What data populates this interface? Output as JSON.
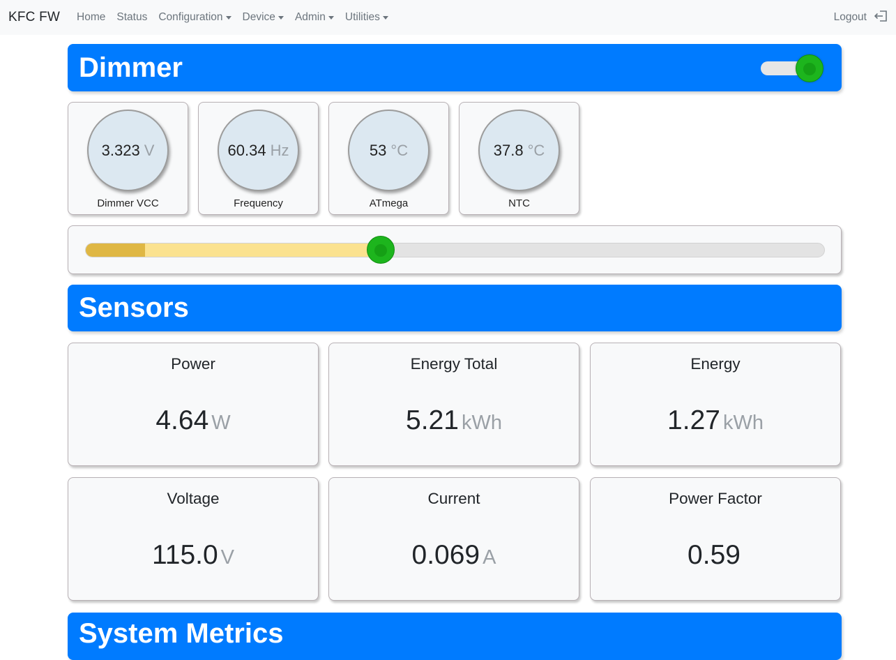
{
  "navbar": {
    "brand": "KFC FW",
    "items": [
      {
        "label": "Home",
        "dropdown": false
      },
      {
        "label": "Status",
        "dropdown": false
      },
      {
        "label": "Configuration",
        "dropdown": true
      },
      {
        "label": "Device",
        "dropdown": true
      },
      {
        "label": "Admin",
        "dropdown": true
      },
      {
        "label": "Utilities",
        "dropdown": true
      }
    ],
    "logout_label": "Logout",
    "logout_icon": "logout-icon"
  },
  "dimmer": {
    "title": "Dimmer",
    "enabled": true,
    "gauges": [
      {
        "value": "3.323",
        "unit": "V",
        "label": "Dimmer VCC"
      },
      {
        "value": "60.34",
        "unit": "Hz",
        "label": "Frequency"
      },
      {
        "value": "53",
        "unit": "°C",
        "label": "ATmega"
      },
      {
        "value": "37.8",
        "unit": "°C",
        "label": "NTC"
      }
    ],
    "level": 0.4,
    "min_level": 0.08
  },
  "sensors": {
    "title": "Sensors",
    "cards": [
      {
        "title": "Power",
        "value": "4.64",
        "unit": "W"
      },
      {
        "title": "Energy Total",
        "value": "5.21",
        "unit": "kWh"
      },
      {
        "title": "Energy",
        "value": "1.27",
        "unit": "kWh"
      },
      {
        "title": "Voltage",
        "value": "115.0",
        "unit": "V"
      },
      {
        "title": "Current",
        "value": "0.069",
        "unit": "A"
      },
      {
        "title": "Power Factor",
        "value": "0.59",
        "unit": ""
      }
    ]
  },
  "system_metrics": {
    "title": "System Metrics"
  },
  "colors": {
    "header": "#007bff",
    "toggle_on": "#1db51d",
    "slider_fill": "#fbe28f",
    "slider_min": "#dfb744"
  }
}
